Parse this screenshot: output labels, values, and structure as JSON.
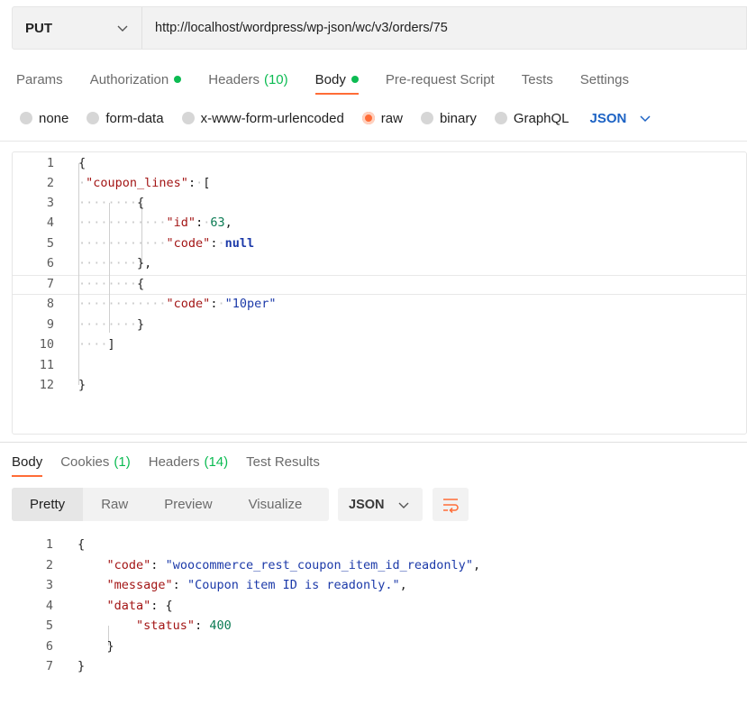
{
  "request": {
    "method": "PUT",
    "url": "http://localhost/wordpress/wp-json/wc/v3/orders/75"
  },
  "request_tabs": [
    {
      "label": "Params"
    },
    {
      "label": "Authorization",
      "dot": true
    },
    {
      "label": "Headers",
      "count": "(10)"
    },
    {
      "label": "Body",
      "dot": true,
      "active": true
    },
    {
      "label": "Pre-request Script"
    },
    {
      "label": "Tests"
    },
    {
      "label": "Settings"
    }
  ],
  "body_types": [
    {
      "label": "none"
    },
    {
      "label": "form-data"
    },
    {
      "label": "x-www-form-urlencoded"
    },
    {
      "label": "raw",
      "selected": true
    },
    {
      "label": "binary"
    },
    {
      "label": "GraphQL"
    }
  ],
  "body_language": "JSON",
  "request_body": {
    "line_numbers": [
      "1",
      "2",
      "3",
      "4",
      "5",
      "6",
      "7",
      "8",
      "9",
      "10",
      "11",
      "12"
    ]
  },
  "response_tabs": [
    {
      "label": "Body",
      "active": true
    },
    {
      "label": "Cookies",
      "count": "(1)"
    },
    {
      "label": "Headers",
      "count": "(14)"
    },
    {
      "label": "Test Results"
    }
  ],
  "response_views": [
    "Pretty",
    "Raw",
    "Preview",
    "Visualize"
  ],
  "response_language": "JSON",
  "response_body": {
    "line_numbers": [
      "1",
      "2",
      "3",
      "4",
      "5",
      "6",
      "7"
    ],
    "code_value": "woocommerce_rest_coupon_item_id_readonly",
    "message_value": "Coupon item ID is readonly.",
    "status_value": "400"
  },
  "colors": {
    "accent": "#ff6c37",
    "status_green": "#0cbb52",
    "link_blue": "#1d63c4"
  }
}
